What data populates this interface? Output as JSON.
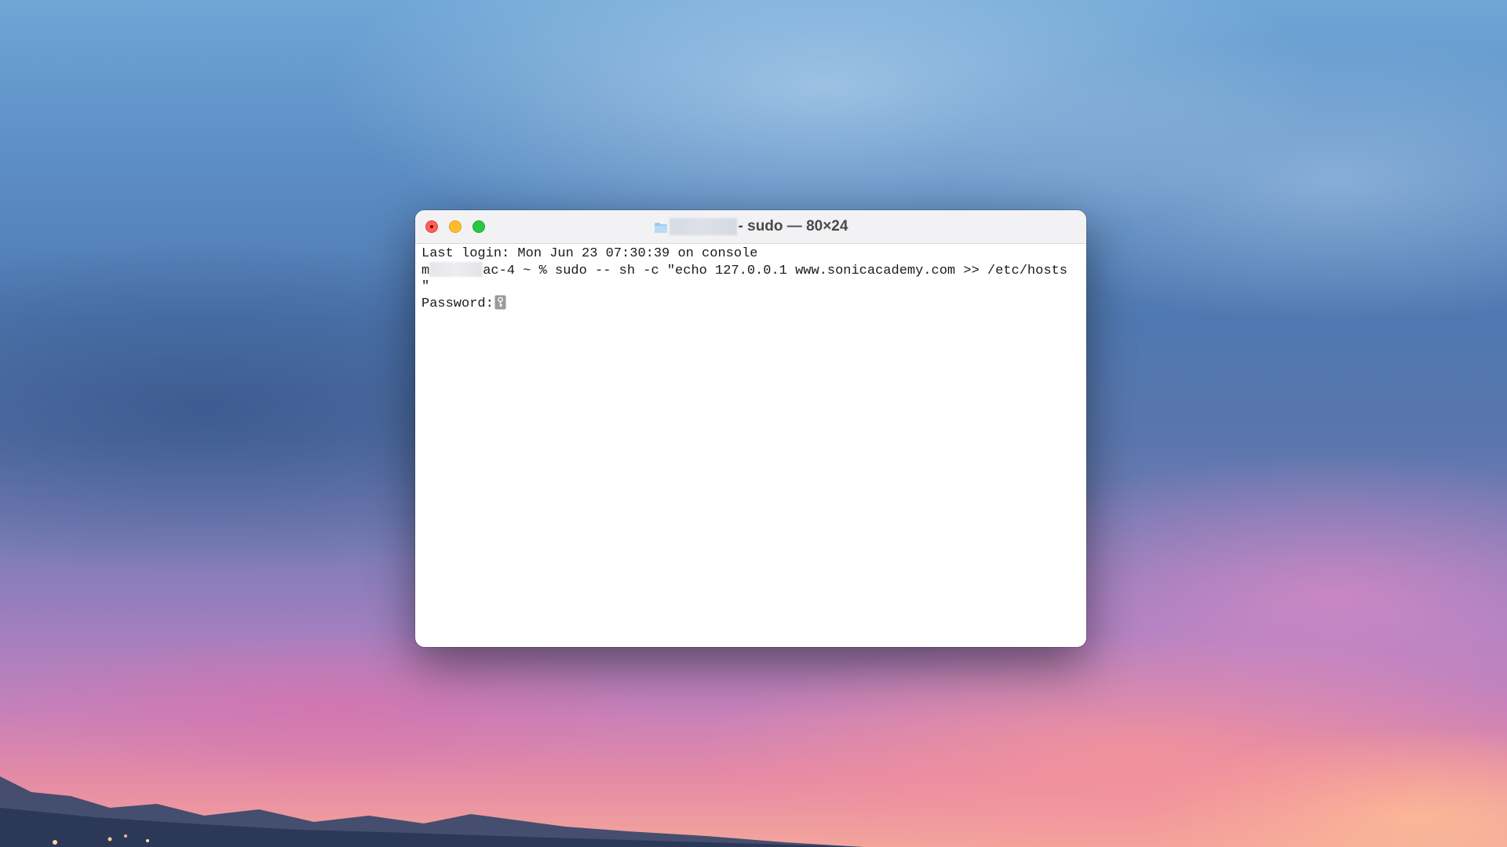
{
  "window": {
    "title_suffix": "- sudo — 80×24"
  },
  "terminal": {
    "line1": "Last login: Mon Jun 23 07:30:39 on console",
    "prompt_start": "m",
    "prompt_rest": "ac-4 ~ % sudo -- sh -c \"echo 127.0.0.1 www.sonicacademy.com >> /etc/hosts",
    "line3": "\"",
    "password_label": "Password:"
  },
  "icons": {
    "close": "close-icon",
    "minimize": "minimize-icon",
    "zoom": "zoom-icon",
    "folder": "folder-icon",
    "key": "key-icon"
  },
  "colors": {
    "close": "#fe5f57",
    "minimize": "#febc2e",
    "zoom": "#28c840",
    "terminal_background": "#ffffff",
    "terminal_text": "#1b1b1b"
  }
}
